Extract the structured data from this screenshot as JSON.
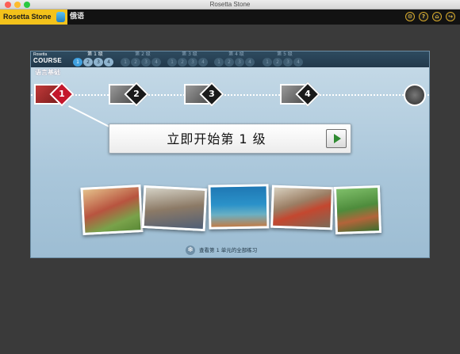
{
  "window": {
    "title": "Rosetta Stone"
  },
  "header": {
    "logo_text": "Rosetta Stone",
    "language": "俄语",
    "icons": [
      "settings-icon",
      "help-icon",
      "home-icon",
      "exit-icon"
    ],
    "icon_glyphs": [
      "⚙",
      "?",
      "⌂",
      "↪"
    ]
  },
  "course": {
    "logo_small": "Rosetta",
    "logo_large": "COURSE",
    "levels": [
      {
        "name": "第 1 级",
        "units": [
          "1",
          "2",
          "3",
          "4"
        ],
        "active": true,
        "current_unit": "1"
      },
      {
        "name": "第 2 级",
        "units": [
          "1",
          "2",
          "3",
          "4"
        ],
        "active": false
      },
      {
        "name": "第 3 级",
        "units": [
          "1",
          "2",
          "3",
          "4"
        ],
        "active": false
      },
      {
        "name": "第 4 级",
        "units": [
          "1",
          "2",
          "3",
          "4"
        ],
        "active": false
      },
      {
        "name": "第 5 级",
        "units": [
          "1",
          "2",
          "3",
          "4"
        ],
        "active": false
      }
    ],
    "section_title": "语言基础",
    "lessons": [
      {
        "number": "1",
        "active": true
      },
      {
        "number": "2",
        "active": false
      },
      {
        "number": "3",
        "active": false
      },
      {
        "number": "4",
        "active": false
      }
    ],
    "start_label": "立即开始第 1 级",
    "review_link": "查看第 1 单元的全部练习"
  },
  "colors": {
    "brand_yellow": "#f3c21b",
    "active_lesson": "#c4172b",
    "play_green": "#2f8a31"
  }
}
